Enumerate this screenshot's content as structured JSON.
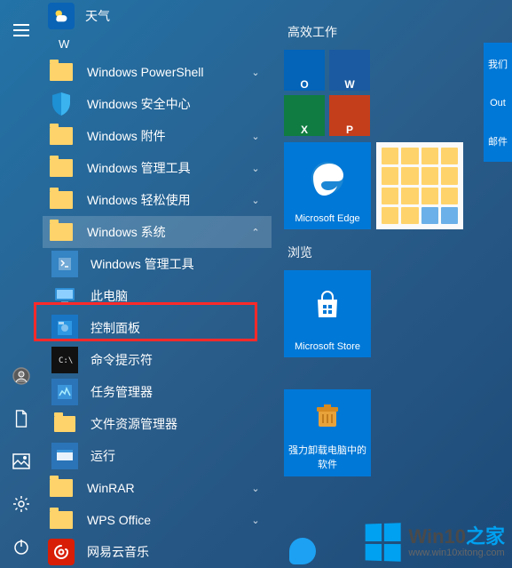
{
  "top_app": {
    "label": "天气"
  },
  "letter_header": "W",
  "apps": [
    {
      "label": "Windows PowerShell",
      "type": "folder",
      "expandable": true,
      "expanded": false
    },
    {
      "label": "Windows 安全中心",
      "type": "shield",
      "expandable": false
    },
    {
      "label": "Windows 附件",
      "type": "folder",
      "expandable": true,
      "expanded": false
    },
    {
      "label": "Windows 管理工具",
      "type": "folder",
      "expandable": true,
      "expanded": false
    },
    {
      "label": "Windows 轻松使用",
      "type": "folder",
      "expandable": true,
      "expanded": false
    },
    {
      "label": "Windows 系统",
      "type": "folder",
      "expandable": true,
      "expanded": true
    }
  ],
  "sub_apps": [
    {
      "label": "Windows 管理工具",
      "icon": "admin-tools"
    },
    {
      "label": "此电脑",
      "icon": "this-pc"
    },
    {
      "label": "控制面板",
      "icon": "control-panel",
      "highlighted": true
    },
    {
      "label": "命令提示符",
      "icon": "cmd"
    },
    {
      "label": "任务管理器",
      "icon": "task-manager"
    },
    {
      "label": "文件资源管理器",
      "icon": "file-explorer"
    },
    {
      "label": "运行",
      "icon": "run"
    }
  ],
  "apps_after": [
    {
      "label": "WinRAR",
      "type": "folder",
      "expandable": true
    },
    {
      "label": "WPS Office",
      "type": "folder",
      "expandable": true
    },
    {
      "label": "网易云音乐",
      "type": "netease"
    }
  ],
  "groups": {
    "productivity": {
      "title": "高效工作",
      "small_tiles": [
        {
          "name": "outlook",
          "bg": "#0364b8",
          "letter": "O"
        },
        {
          "name": "word",
          "bg": "#1b5aa0",
          "letter": "W"
        },
        {
          "name": "excel",
          "bg": "#107c41",
          "letter": "X"
        },
        {
          "name": "powerpoint",
          "bg": "#c43e1c",
          "letter": "P"
        }
      ],
      "right_labels": [
        "我们",
        "Out",
        "",
        "邮件"
      ],
      "edge_label": "Microsoft Edge"
    },
    "browse": {
      "title": "浏览",
      "store_label": "Microsoft Store",
      "uninstall_label": "强力卸载电脑中的软件"
    }
  },
  "watermark": {
    "brand_prefix": "Win10",
    "brand_suffix": "之家",
    "url": "www.win10xitong.com"
  }
}
